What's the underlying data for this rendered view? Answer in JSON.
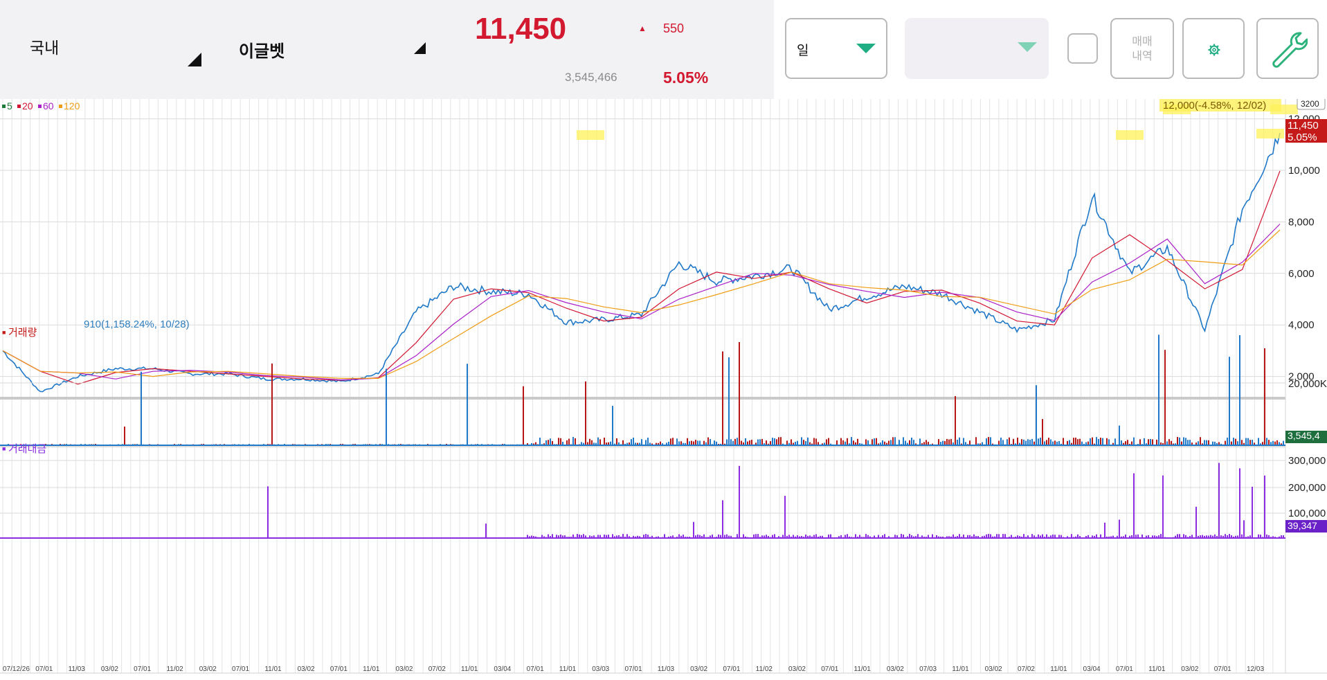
{
  "header": {
    "market": "국내",
    "stock_name": "이글벳",
    "price": "11,450",
    "change_arrow": "▲",
    "change": "550",
    "volume": "3,545,466",
    "change_rate": "5.05%",
    "period_select": "일",
    "sub_select": "",
    "trade_history_label": "매매\n내역",
    "settings_icon": "gear-icon",
    "tools_icon": "wrench-icon",
    "colors": {
      "up": "#d2192f",
      "accent": "#1fae84",
      "tool": "#2bb37b"
    }
  },
  "legend": {
    "ma": [
      {
        "label": "5",
        "color": "#1b7a3a"
      },
      {
        "label": "20",
        "color": "#d21530"
      },
      {
        "label": "60",
        "color": "#a91ec7"
      },
      {
        "label": "120",
        "color": "#ef9c12"
      }
    ],
    "volume_title": "거래량",
    "amount_title": "거래대금"
  },
  "price_panel": {
    "y_ticks": [
      "12,000",
      "10,000",
      "8,000",
      "6,000",
      "4,000",
      "2,000"
    ],
    "max_label": "12,000(-4.58%, 12/02)",
    "min_label": "910(1,158.24%, 10/28)",
    "current_price_tag": "11,450",
    "current_rate_tag": "5.05%",
    "zoom_badge": "3200"
  },
  "volume_panel": {
    "y_tick": "20,000K",
    "current_tag": "3,545,4"
  },
  "amount_panel": {
    "y_ticks": [
      "300,000",
      "200,000",
      "100,000"
    ],
    "current_tag": "39,347"
  },
  "x_axis": [
    "07/12/26",
    "07/01",
    "11/03",
    "03/02",
    "07/01",
    "11/02",
    "03/02",
    "07/01",
    "11/01",
    "03/02",
    "07/01",
    "11/01",
    "03/02",
    "07/02",
    "11/01",
    "03/04",
    "07/01",
    "11/01",
    "03/03",
    "07/01",
    "11/03",
    "03/02",
    "07/01",
    "11/02",
    "03/02",
    "07/01",
    "11/01",
    "03/02",
    "07/03",
    "11/01",
    "03/02",
    "07/02",
    "11/01",
    "03/04",
    "07/01",
    "11/01",
    "03/02",
    "07/01",
    "12/03"
  ],
  "chart_data": {
    "type": "candlestick",
    "y_range": [
      0,
      12500
    ],
    "close_series": [
      {
        "x": "07/12/26",
        "y": 3000
      },
      {
        "x": "11/03",
        "y": 1400
      },
      {
        "x": "03/02",
        "y": 2000
      },
      {
        "x": "07/01",
        "y": 2300
      },
      {
        "x": "11/02",
        "y": 2300
      },
      {
        "x": "03/02",
        "y": 2100
      },
      {
        "x": "07/01",
        "y": 2100
      },
      {
        "x": "11/01",
        "y": 1900
      },
      {
        "x": "03/02",
        "y": 1900
      },
      {
        "x": "07/01",
        "y": 1800
      },
      {
        "x": "11/01",
        "y": 2100
      },
      {
        "x": "03/04",
        "y": 4500
      },
      {
        "x": "07/01",
        "y": 5500
      },
      {
        "x": "11/01",
        "y": 5300
      },
      {
        "x": "03/03",
        "y": 5200
      },
      {
        "x": "07/01",
        "y": 4100
      },
      {
        "x": "11/03",
        "y": 4200
      },
      {
        "x": "03/02",
        "y": 4400
      },
      {
        "x": "07/01",
        "y": 6400
      },
      {
        "x": "11/02",
        "y": 5700
      },
      {
        "x": "03/02",
        "y": 5900
      },
      {
        "x": "07/01",
        "y": 6200
      },
      {
        "x": "11/01",
        "y": 4600
      },
      {
        "x": "03/02",
        "y": 5100
      },
      {
        "x": "07/03",
        "y": 5500
      },
      {
        "x": "11/01",
        "y": 5200
      },
      {
        "x": "03/02",
        "y": 4500
      },
      {
        "x": "07/02",
        "y": 3800
      },
      {
        "x": "11/01",
        "y": 4200
      },
      {
        "x": "03/04",
        "y": 9000
      },
      {
        "x": "07/01",
        "y": 6000
      },
      {
        "x": "11/01",
        "y": 7000
      },
      {
        "x": "03/02",
        "y": 3800
      },
      {
        "x": "07/01",
        "y": 8500
      },
      {
        "x": "12/03",
        "y": 11450
      }
    ],
    "ma_series": [
      "5",
      "20",
      "60",
      "120"
    ]
  }
}
